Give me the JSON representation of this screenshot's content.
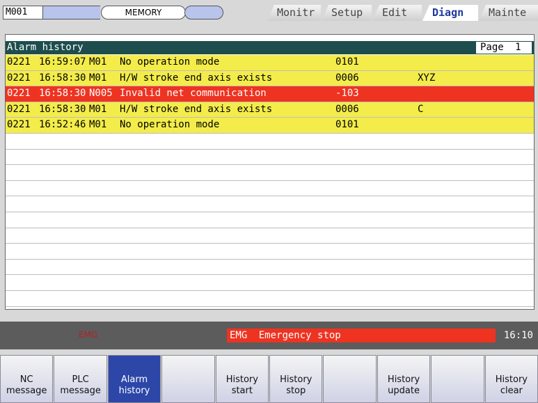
{
  "header": {
    "system_id": "M001",
    "mode": "MEMORY",
    "tabs": [
      {
        "label": "Monitr",
        "active": false
      },
      {
        "label": "Setup",
        "active": false
      },
      {
        "label": "Edit",
        "active": false
      },
      {
        "label": "Diagn",
        "active": true
      },
      {
        "label": "Mainte",
        "active": false
      }
    ]
  },
  "alarm_history": {
    "title": "Alarm history",
    "page_label": "Page",
    "page_number": "1",
    "rows": [
      {
        "date": "0221",
        "time": "16:59:07",
        "no": "M01",
        "message": "No operation mode",
        "code": "0101",
        "axis": "",
        "status": "yellow"
      },
      {
        "date": "0221",
        "time": "16:58:30",
        "no": "M01",
        "message": "H/W stroke end axis exists",
        "code": "0006",
        "axis": "XYZ",
        "status": "yellow"
      },
      {
        "date": "0221",
        "time": "16:58:30",
        "no": "N005",
        "message": "Invalid net communication",
        "code": "-103",
        "axis": "",
        "status": "red"
      },
      {
        "date": "0221",
        "time": "16:58:30",
        "no": "M01",
        "message": "H/W stroke end axis exists",
        "code": "0006",
        "axis": "C",
        "status": "yellow"
      },
      {
        "date": "0221",
        "time": "16:52:46",
        "no": "M01",
        "message": "No operation mode",
        "code": "0101",
        "axis": "",
        "status": "yellow"
      }
    ],
    "empty_row_count": 11
  },
  "status_bar": {
    "emg_indicator": "EMG",
    "alarm_tag": "EMG",
    "alarm_text": "Emergency stop",
    "clock": "16:10"
  },
  "softkeys": [
    {
      "line1": "NC",
      "line2": "message",
      "active": false
    },
    {
      "line1": "PLC",
      "line2": "message",
      "active": false
    },
    {
      "line1": "Alarm",
      "line2": "history",
      "active": true
    },
    {
      "line1": "",
      "line2": "",
      "active": false
    },
    {
      "line1": "History",
      "line2": "start",
      "active": false
    },
    {
      "line1": "History",
      "line2": "stop",
      "active": false
    },
    {
      "line1": "",
      "line2": "",
      "active": false
    },
    {
      "line1": "History",
      "line2": "update",
      "active": false
    },
    {
      "line1": "",
      "line2": "",
      "active": false
    },
    {
      "line1": "History",
      "line2": "clear",
      "active": false
    }
  ],
  "colors": {
    "alarm_yellow": "#f3ec4a",
    "alarm_red": "#ee3321",
    "title_bar": "#1e4d4d",
    "active_key": "#2d47a8"
  }
}
